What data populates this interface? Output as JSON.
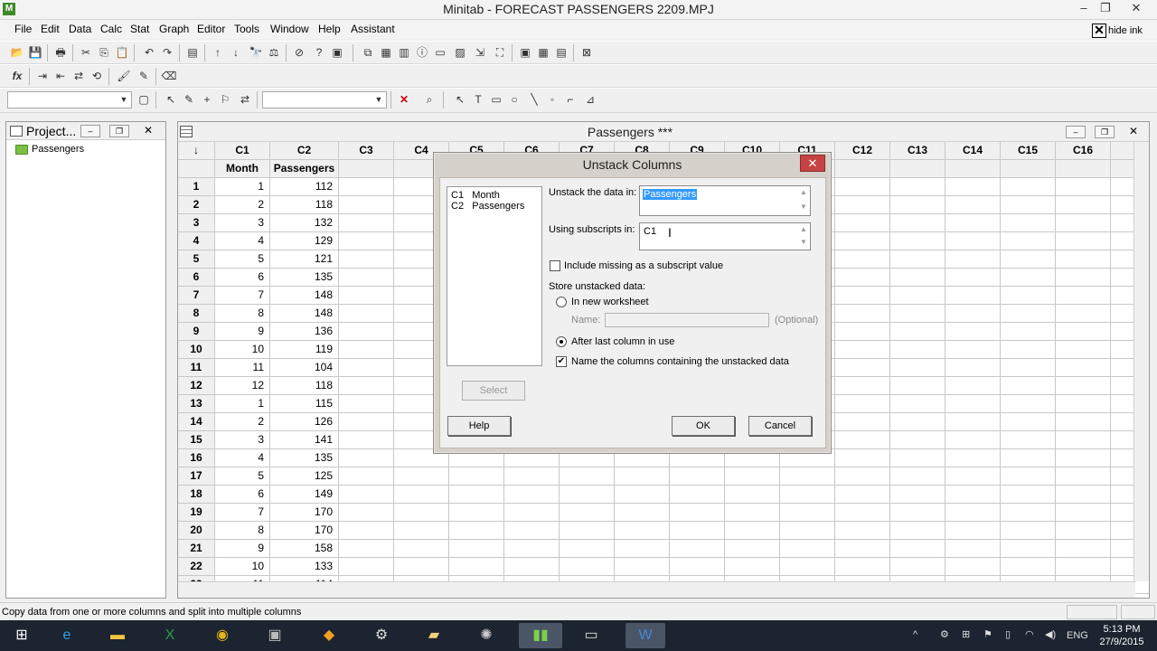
{
  "window": {
    "title": "Minitab - FORECAST PASSENGERS 2209.MPJ",
    "app_icon": "minitab-icon",
    "controls": [
      "minimize-icon",
      "restore-icon",
      "close-icon"
    ]
  },
  "menu": {
    "items": [
      "File",
      "Edit",
      "Data",
      "Calc",
      "Stat",
      "Graph",
      "Editor",
      "Tools",
      "Window",
      "Help",
      "Assistant"
    ]
  },
  "hide_ink": {
    "label": "hide ink"
  },
  "toolbar1": {
    "icons": [
      "open-icon",
      "save-icon",
      "print-icon",
      "cut-icon",
      "copy-icon",
      "paste-icon",
      "undo-icon",
      "redo-icon",
      "edit-last-dialog-icon",
      "prev-icon",
      "next-icon",
      "find-icon",
      "replace-icon",
      "cancel-icon",
      "help-icon",
      "stop-icon",
      "session-icon",
      "project-manager-icon",
      "worksheet-icon",
      "info-icon",
      "history-icon",
      "graph-folder-icon",
      "report-pad-icon",
      "related-docs-icon",
      "design-icon",
      "tile-icon",
      "close-all-icon"
    ]
  },
  "toolbar2": {
    "icons": [
      "formula-icon",
      "insert-rows-icon",
      "insert-columns-icon",
      "move-columns-icon",
      "update-graph-icon",
      "brush-icon",
      "eraser-icon"
    ]
  },
  "toolbar3": {
    "icons": [
      "graph-select-icon",
      "pointer-icon",
      "text-icon",
      "rectangle-icon",
      "ellipse-icon",
      "line-icon",
      "polyline-icon",
      "marker-icon",
      "polygon-icon",
      "zoom-icon",
      "delete-icon"
    ]
  },
  "project_pane": {
    "title": "Project...",
    "tree_item": "Passengers"
  },
  "worksheet": {
    "title": "Passengers ***",
    "columns": [
      "C1",
      "C2",
      "C3",
      "C4",
      "C5",
      "C6",
      "C7",
      "C8",
      "C9",
      "C10",
      "C11",
      "C12",
      "C13",
      "C14",
      "C15",
      "C16",
      "C"
    ],
    "col_names": [
      "Month",
      "Passengers"
    ],
    "row_header_icon": "↓",
    "rows": [
      [
        "1",
        "1",
        "112"
      ],
      [
        "2",
        "2",
        "118"
      ],
      [
        "3",
        "3",
        "132"
      ],
      [
        "4",
        "4",
        "129"
      ],
      [
        "5",
        "5",
        "121"
      ],
      [
        "6",
        "6",
        "135"
      ],
      [
        "7",
        "7",
        "148"
      ],
      [
        "8",
        "8",
        "148"
      ],
      [
        "9",
        "9",
        "136"
      ],
      [
        "10",
        "10",
        "119"
      ],
      [
        "11",
        "11",
        "104"
      ],
      [
        "12",
        "12",
        "118"
      ],
      [
        "13",
        "1",
        "115"
      ],
      [
        "14",
        "2",
        "126"
      ],
      [
        "15",
        "3",
        "141"
      ],
      [
        "16",
        "4",
        "135"
      ],
      [
        "17",
        "5",
        "125"
      ],
      [
        "18",
        "6",
        "149"
      ],
      [
        "19",
        "7",
        "170"
      ],
      [
        "20",
        "8",
        "170"
      ],
      [
        "21",
        "9",
        "158"
      ],
      [
        "22",
        "10",
        "133"
      ],
      [
        "23",
        "11",
        "114"
      ]
    ]
  },
  "dialog": {
    "title": "Unstack Columns",
    "variables": [
      {
        "col": "C1",
        "name": "Month"
      },
      {
        "col": "C2",
        "name": "Passengers"
      }
    ],
    "unstack_label": "Unstack the data in:",
    "unstack_value": "Passengers",
    "subscripts_label": "Using subscripts in:",
    "subscripts_value": "C1",
    "include_missing_label": "Include missing as a subscript value",
    "include_missing_checked": false,
    "store_label": "Store unstacked data:",
    "new_worksheet_label": "In new worksheet",
    "name_label": "Name:",
    "name_value": "",
    "optional_label": "(Optional)",
    "after_last_label": "After last column in use",
    "name_columns_label": "Name the columns containing the unstacked data",
    "name_columns_checked": true,
    "select_button": "Select",
    "help_button": "Help",
    "ok_button": "OK",
    "cancel_button": "Cancel"
  },
  "status": {
    "text": "Copy data from one or more columns and split into multiple columns"
  },
  "taskbar": {
    "apps": [
      "windows-start-icon",
      "internet-explorer-icon",
      "file-explorer-icon",
      "excel-icon",
      "chrome-icon",
      "app-icon",
      "toolkit-icon",
      "steam-icon",
      "folder-icon",
      "app-orb-icon",
      "minitab-icon",
      "window-icon",
      "word-icon"
    ],
    "language": "ENG",
    "time": "5:13 PM",
    "date": "27/9/2015"
  }
}
